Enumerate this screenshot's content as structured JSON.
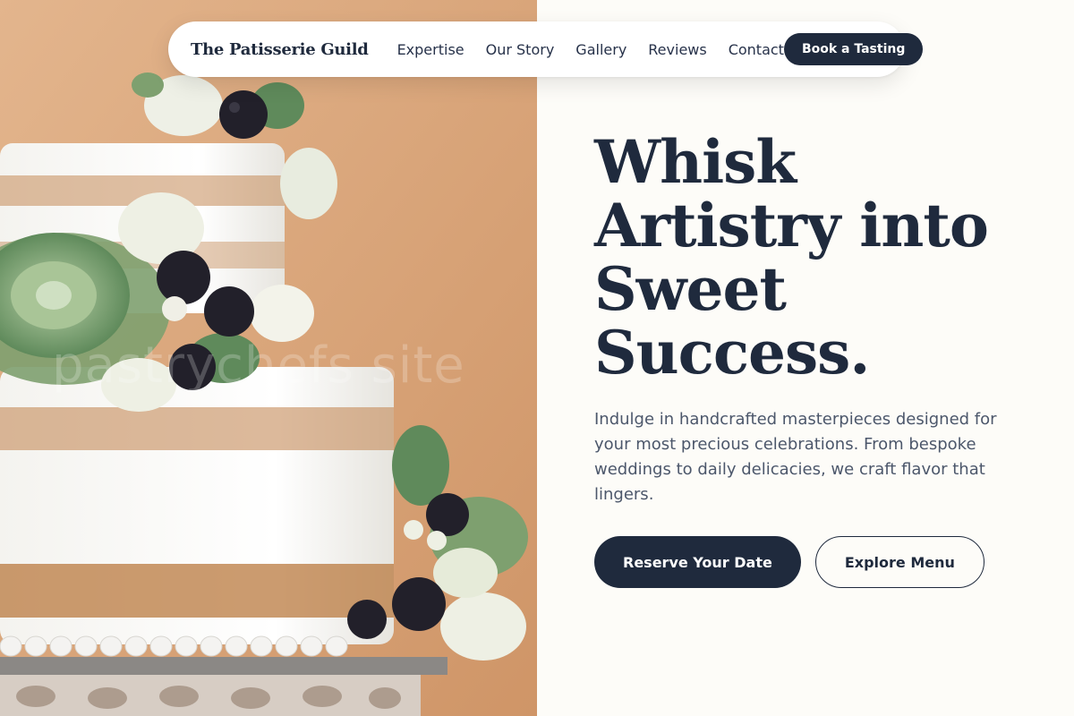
{
  "nav": {
    "brand": "The Patisserie Guild",
    "links": [
      "Expertise",
      "Our Story",
      "Gallery",
      "Reviews",
      "Contact"
    ],
    "cta": "Book a Tasting"
  },
  "hero": {
    "headline_lines": [
      "Whisk",
      "Artistry into",
      "Sweet",
      "Success."
    ],
    "lede": "Indulge in handcrafted masterpieces designed for your most precious celebrations. From bespoke weddings to daily delicacies, we craft flavor that lingers.",
    "primary_button": "Reserve Your Date",
    "secondary_button": "Explore Menu"
  },
  "photo": {
    "alt": "Three-tier naked wedding cake decorated with succulents, white roses and blackberries",
    "watermark": "pastrychefs site"
  },
  "colors": {
    "navy": "#1f2a3d",
    "cream": "#fdfcf8",
    "body_text": "#4c576b",
    "photo_bg": "#d9a47a"
  }
}
